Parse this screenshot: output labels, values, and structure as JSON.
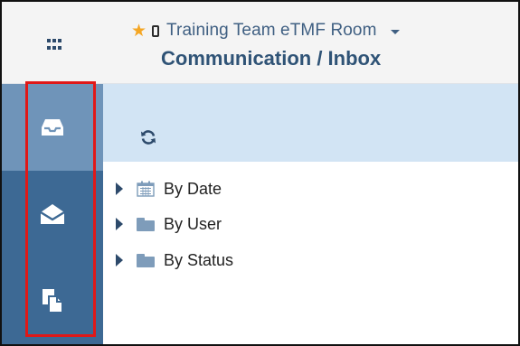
{
  "header": {
    "room_name": "Training Team eTMF Room",
    "page_title": "Communication / Inbox",
    "icons": [
      "apps-grid-icon",
      "star-icon",
      "phone-icon",
      "caret-down-icon"
    ],
    "star_color": "#f5a623"
  },
  "sidebar": {
    "background": "#3d6994",
    "active_background": "#6f94b9",
    "items": [
      {
        "icon": "inbox-tray-icon",
        "active": true
      },
      {
        "icon": "open-envelope-icon",
        "active": false
      },
      {
        "icon": "copy-documents-icon",
        "active": false
      }
    ],
    "highlight_color": "#e01818"
  },
  "toolbar": {
    "background": "#d2e4f4",
    "icon": "refresh-icon"
  },
  "tree": {
    "items": [
      {
        "label": "By Date",
        "icon": "calendar-icon"
      },
      {
        "label": "By User",
        "icon": "folder-icon"
      },
      {
        "label": "By Status",
        "icon": "folder-icon"
      }
    ]
  }
}
